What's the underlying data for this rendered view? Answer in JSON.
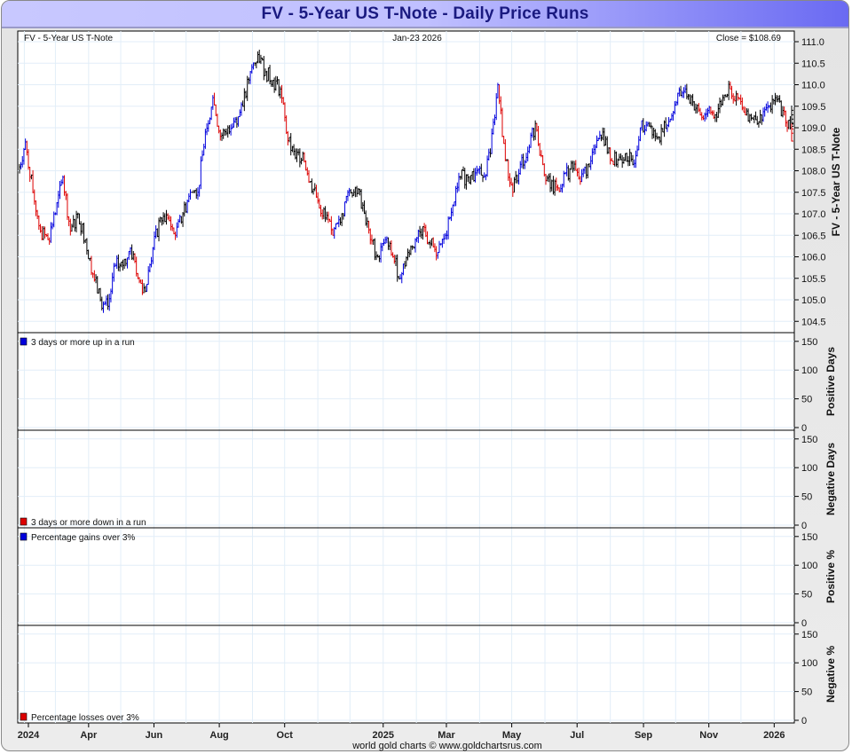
{
  "window_title": "FV  -  5-Year US T-Note - Daily Price Runs",
  "header": {
    "left": "FV  -  5-Year US T-Note",
    "center": "Jan-23  2026",
    "right": "Close = $108.69"
  },
  "footer": "world gold charts © www.goldchartsrus.com",
  "colors": {
    "up_run": "#0000dd",
    "down_run": "#dd0000",
    "neutral": "#000000",
    "grid": "#e2eef8",
    "title_text": "#1a1a80"
  },
  "chart_data": [
    {
      "type": "ohlc",
      "ylabel": "FV  -  5-Year US T-Note",
      "ylim": [
        104.3,
        111.25
      ],
      "yticks": [
        "111.0",
        "110.5",
        "110.0",
        "109.5",
        "109.0",
        "108.5",
        "108.0",
        "107.5",
        "107.0",
        "106.5",
        "106.0",
        "105.5",
        "105.0",
        "104.5"
      ],
      "x_start": "2024-01-26",
      "x_interval": "weekly",
      "x_end": "2026-01-23",
      "weekly_close": [
        107.95,
        108.67,
        107.5,
        106.6,
        106.4,
        107.0,
        107.85,
        106.6,
        107.0,
        106.4,
        105.6,
        105.0,
        104.85,
        105.8,
        105.8,
        106.2,
        105.5,
        105.2,
        106.2,
        106.9,
        106.9,
        106.5,
        107.0,
        107.5,
        107.5,
        108.9,
        109.7,
        108.8,
        109.0,
        109.2,
        109.5,
        110.3,
        110.7,
        110.3,
        110.1,
        109.9,
        108.7,
        108.3,
        108.4,
        107.75,
        107.3,
        106.9,
        106.5,
        106.8,
        107.5,
        107.6,
        107.2,
        106.4,
        106.0,
        106.4,
        106.0,
        105.5,
        106.1,
        106.4,
        106.7,
        106.3,
        106.1,
        106.5,
        107.2,
        107.85,
        107.85,
        107.95,
        107.85,
        108.4,
        110.0,
        108.25,
        107.5,
        108.15,
        108.45,
        109.1,
        108.15,
        107.6,
        107.6,
        107.95,
        108.05,
        107.75,
        108.15,
        108.55,
        108.9,
        108.25,
        108.25,
        108.4,
        108.15,
        109.0,
        109.1,
        108.8,
        108.9,
        109.2,
        109.8,
        109.9,
        109.6,
        109.3,
        109.4,
        109.3,
        109.7,
        109.9,
        109.7,
        109.3,
        109.2,
        109.3,
        109.5,
        109.7,
        109.4,
        109.0,
        109.3,
        108.69
      ],
      "x_tick_labels": [
        "2024",
        "Apr",
        "Jun",
        "Aug",
        "Oct",
        "2025",
        "Mar",
        "May",
        "Jul",
        "Sep",
        "Nov",
        "2026"
      ]
    },
    {
      "type": "bar",
      "ylabel": "Positive Days",
      "legend": "3 days or more up in a run",
      "yticks": [
        "150",
        "100",
        "50",
        "0"
      ],
      "ylim": [
        0,
        170
      ],
      "values": []
    },
    {
      "type": "bar",
      "ylabel": "Negative Days",
      "legend": "3 days or more down in a run",
      "yticks": [
        "150",
        "100",
        "50",
        "0"
      ],
      "ylim": [
        0,
        170
      ],
      "values": []
    },
    {
      "type": "bar",
      "ylabel": "Positive %",
      "legend": "Percentage gains over 3%",
      "yticks": [
        "150",
        "100",
        "50",
        "0"
      ],
      "ylim": [
        0,
        170
      ],
      "values": []
    },
    {
      "type": "bar",
      "ylabel": "Negative %",
      "legend": "Percentage losses over 3%",
      "yticks": [
        "150",
        "100",
        "50",
        "0"
      ],
      "ylim": [
        0,
        170
      ],
      "values": []
    }
  ]
}
